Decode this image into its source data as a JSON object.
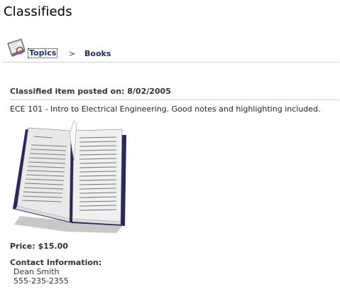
{
  "page": {
    "title": "Classifieds"
  },
  "breadcrumb": {
    "topics_label": "Topics",
    "separator": ">",
    "current": "Books",
    "icon": "topics-book-icon"
  },
  "item": {
    "posted_label": "Classified item posted on: 8/02/2005",
    "description": "ECE 101 - Intro to Electrical Engineering. Good notes and highlighting included.",
    "image": "open-book-image",
    "price": "Price: $15.00",
    "contact_label": "Contact Information:",
    "contact_name": "Dean Smith",
    "contact_phone": "555-235-2355"
  },
  "colors": {
    "link": "#1a2e6e",
    "rule": "#d0d0d0"
  }
}
